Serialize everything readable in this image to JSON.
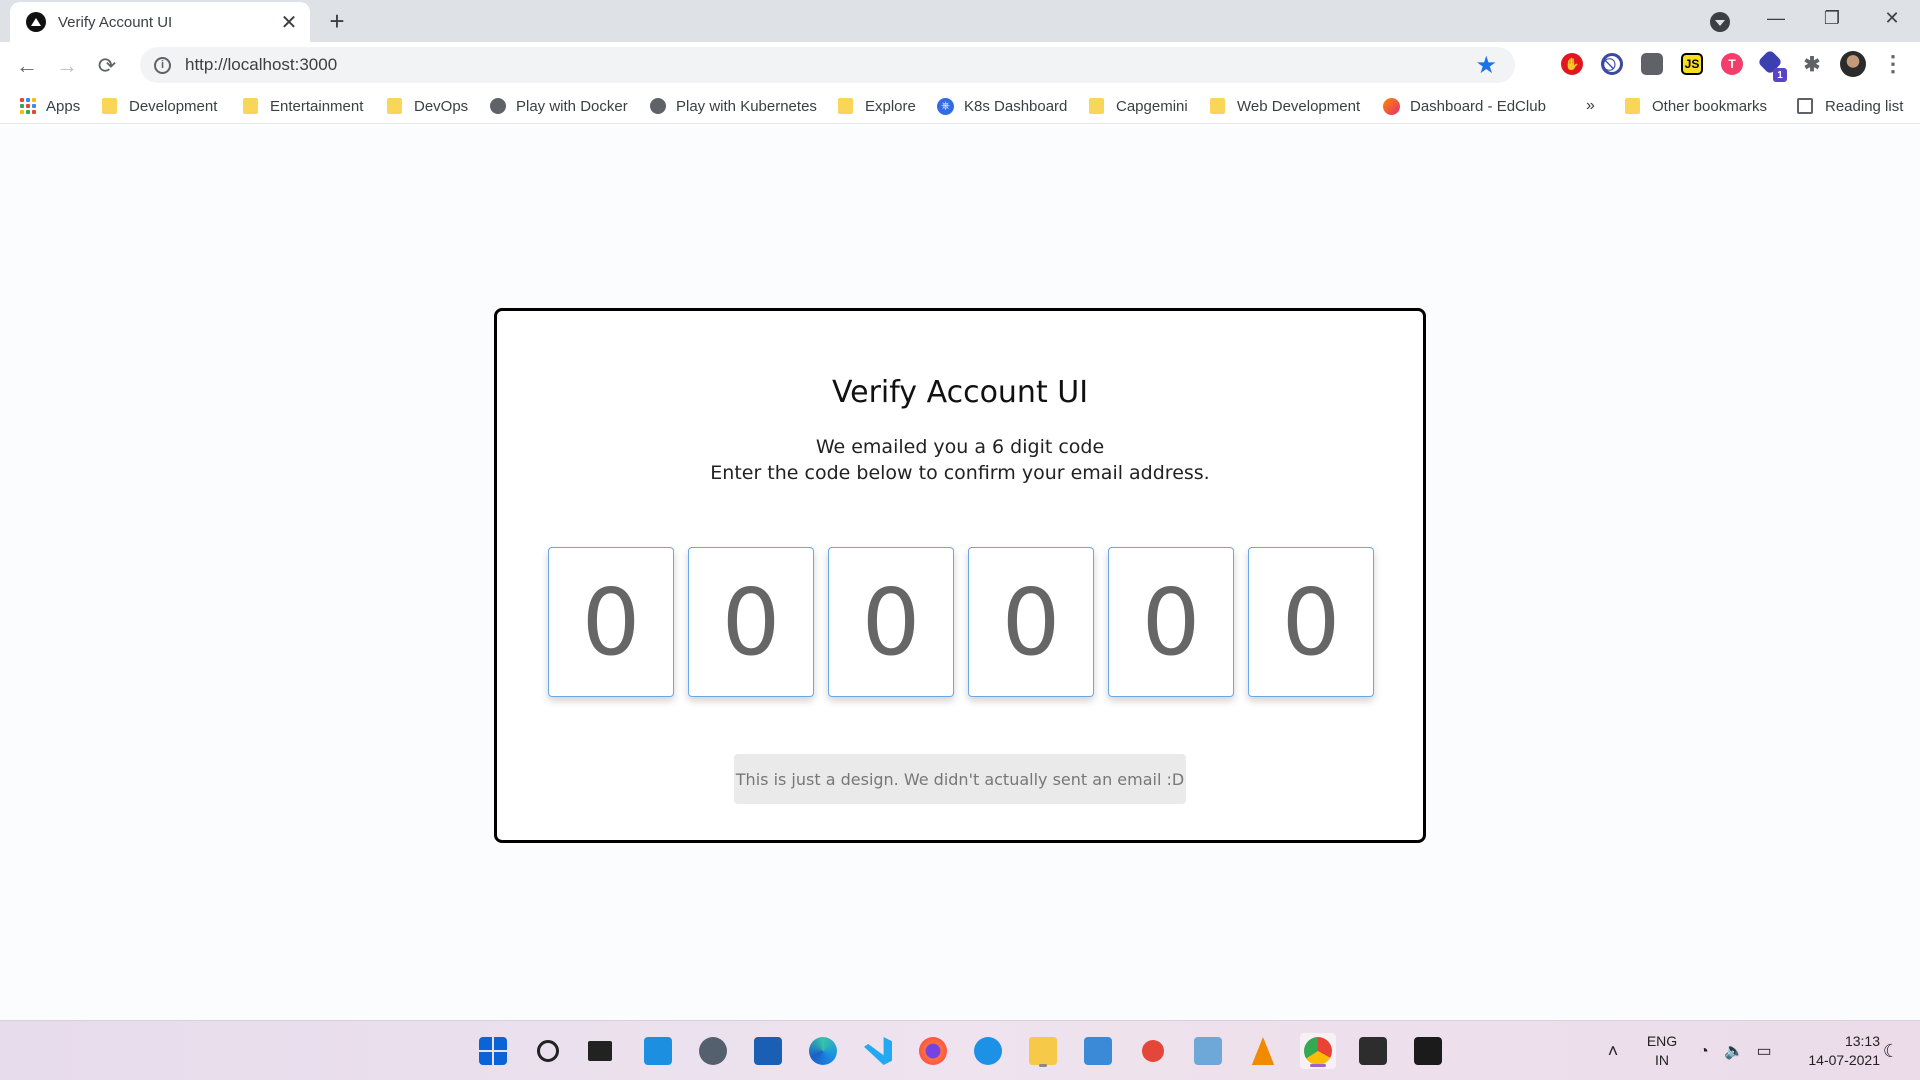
{
  "browser": {
    "tab_title": "Verify Account UI",
    "url": "http://localhost:3000",
    "bookmarks": [
      {
        "label": "Apps",
        "icon": "apps-grid-icon"
      },
      {
        "label": "Development",
        "icon": "folder-icon"
      },
      {
        "label": "Entertainment",
        "icon": "folder-icon"
      },
      {
        "label": "DevOps",
        "icon": "folder-icon"
      },
      {
        "label": "Play with Docker",
        "icon": "globe-icon"
      },
      {
        "label": "Play with Kubernetes",
        "icon": "globe-icon"
      },
      {
        "label": "Explore",
        "icon": "folder-icon"
      },
      {
        "label": "K8s Dashboard",
        "icon": "kubernetes-icon"
      },
      {
        "label": "Capgemini",
        "icon": "folder-icon"
      },
      {
        "label": "Web Development",
        "icon": "folder-icon"
      },
      {
        "label": "Dashboard - EdClub",
        "icon": "edclub-icon"
      }
    ],
    "overflow": "»",
    "other_bookmarks": "Other bookmarks",
    "reading_list": "Reading list",
    "extension_labels": {
      "js": "JS",
      "tampermonkey": "T",
      "badge": "1"
    }
  },
  "page": {
    "title": "Verify Account UI",
    "line1": "We emailed you a 6 digit code",
    "line2": "Enter the code below to confirm your email address.",
    "digits": [
      "0",
      "0",
      "0",
      "0",
      "0",
      "0"
    ],
    "note": "This is just a design. We didn't actually sent an email :D"
  },
  "taskbar": {
    "lang_top": "ENG",
    "lang_bottom": "IN",
    "time": "13:13",
    "date": "14-07-2021"
  },
  "colors": {
    "accent": "#1a73e8",
    "digit_border": "#69a8e8",
    "folder": "#f9d65a"
  }
}
